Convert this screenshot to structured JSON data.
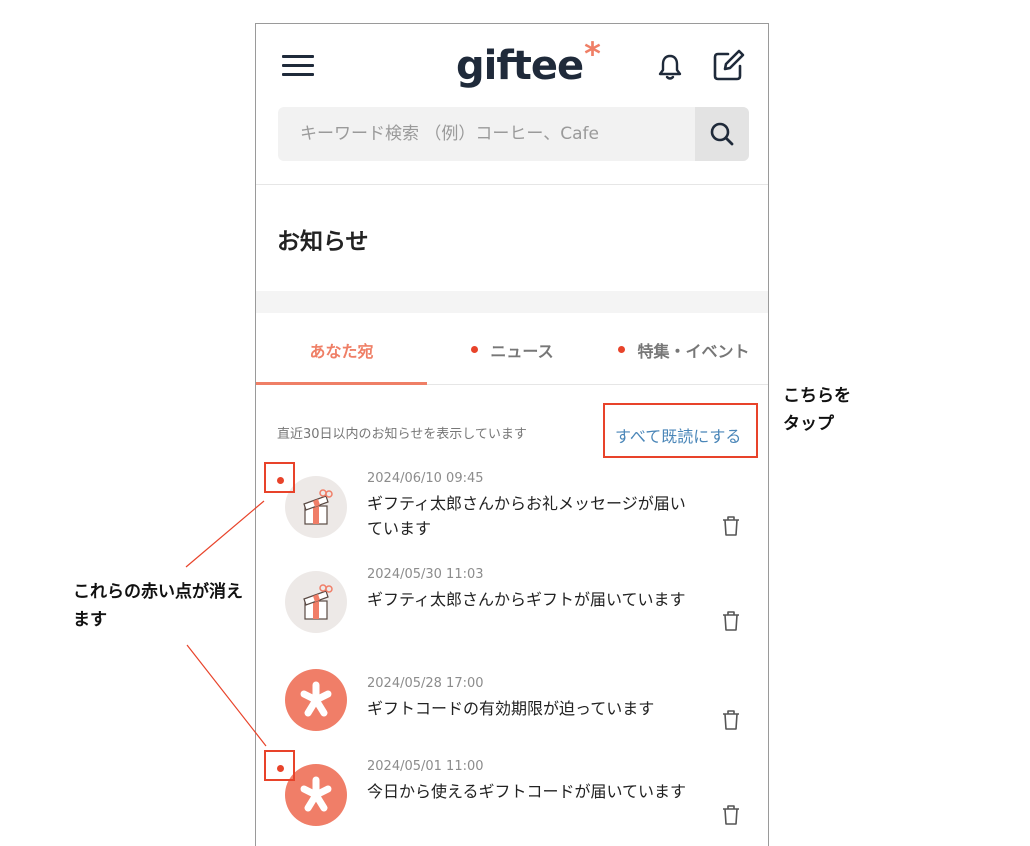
{
  "header": {
    "logo_text": "giftee",
    "logo_star": "*",
    "icons": [
      "hamburger-menu-icon",
      "bell-icon",
      "edit-icon",
      "search-icon"
    ]
  },
  "search": {
    "placeholder": "キーワード検索 （例）コーヒー、Cafe",
    "value": ""
  },
  "page_title": "お知らせ",
  "tabs": [
    {
      "label": "あなた宛",
      "active": true,
      "unread": false
    },
    {
      "label": "ニュース",
      "active": false,
      "unread": true
    },
    {
      "label": "特集・イベント",
      "active": false,
      "unread": true
    }
  ],
  "notice": "直近30日以内のお知らせを表示しています",
  "mark_all_read_label": "すべて既読にする",
  "items": [
    {
      "date": "2024/06/10 09:45",
      "message": "ギフティ太郎さんからお礼メッセージが届いています",
      "icon": "gift-box-icon",
      "unread": true
    },
    {
      "date": "2024/05/30 11:03",
      "message": "ギフティ太郎さんからギフトが届いています",
      "icon": "gift-box-icon",
      "unread": false
    },
    {
      "date": "2024/05/28 17:00",
      "message": "ギフトコードの有効期限が迫っています",
      "icon": "giftee-asterisk-icon",
      "unread": false
    },
    {
      "date": "2024/05/01 11:00",
      "message": "今日から使えるギフトコードが届いています",
      "icon": "giftee-asterisk-icon",
      "unread": true
    }
  ],
  "annotations": {
    "tap_here": "こちらをタップ",
    "dots_disappear": "これらの赤い点が消えます"
  },
  "colors": {
    "accent": "#ef7f66",
    "unread_dot": "#e8432a",
    "annotation": "#e8432a",
    "link": "#4a86b8",
    "navy": "#1f2a3a"
  }
}
